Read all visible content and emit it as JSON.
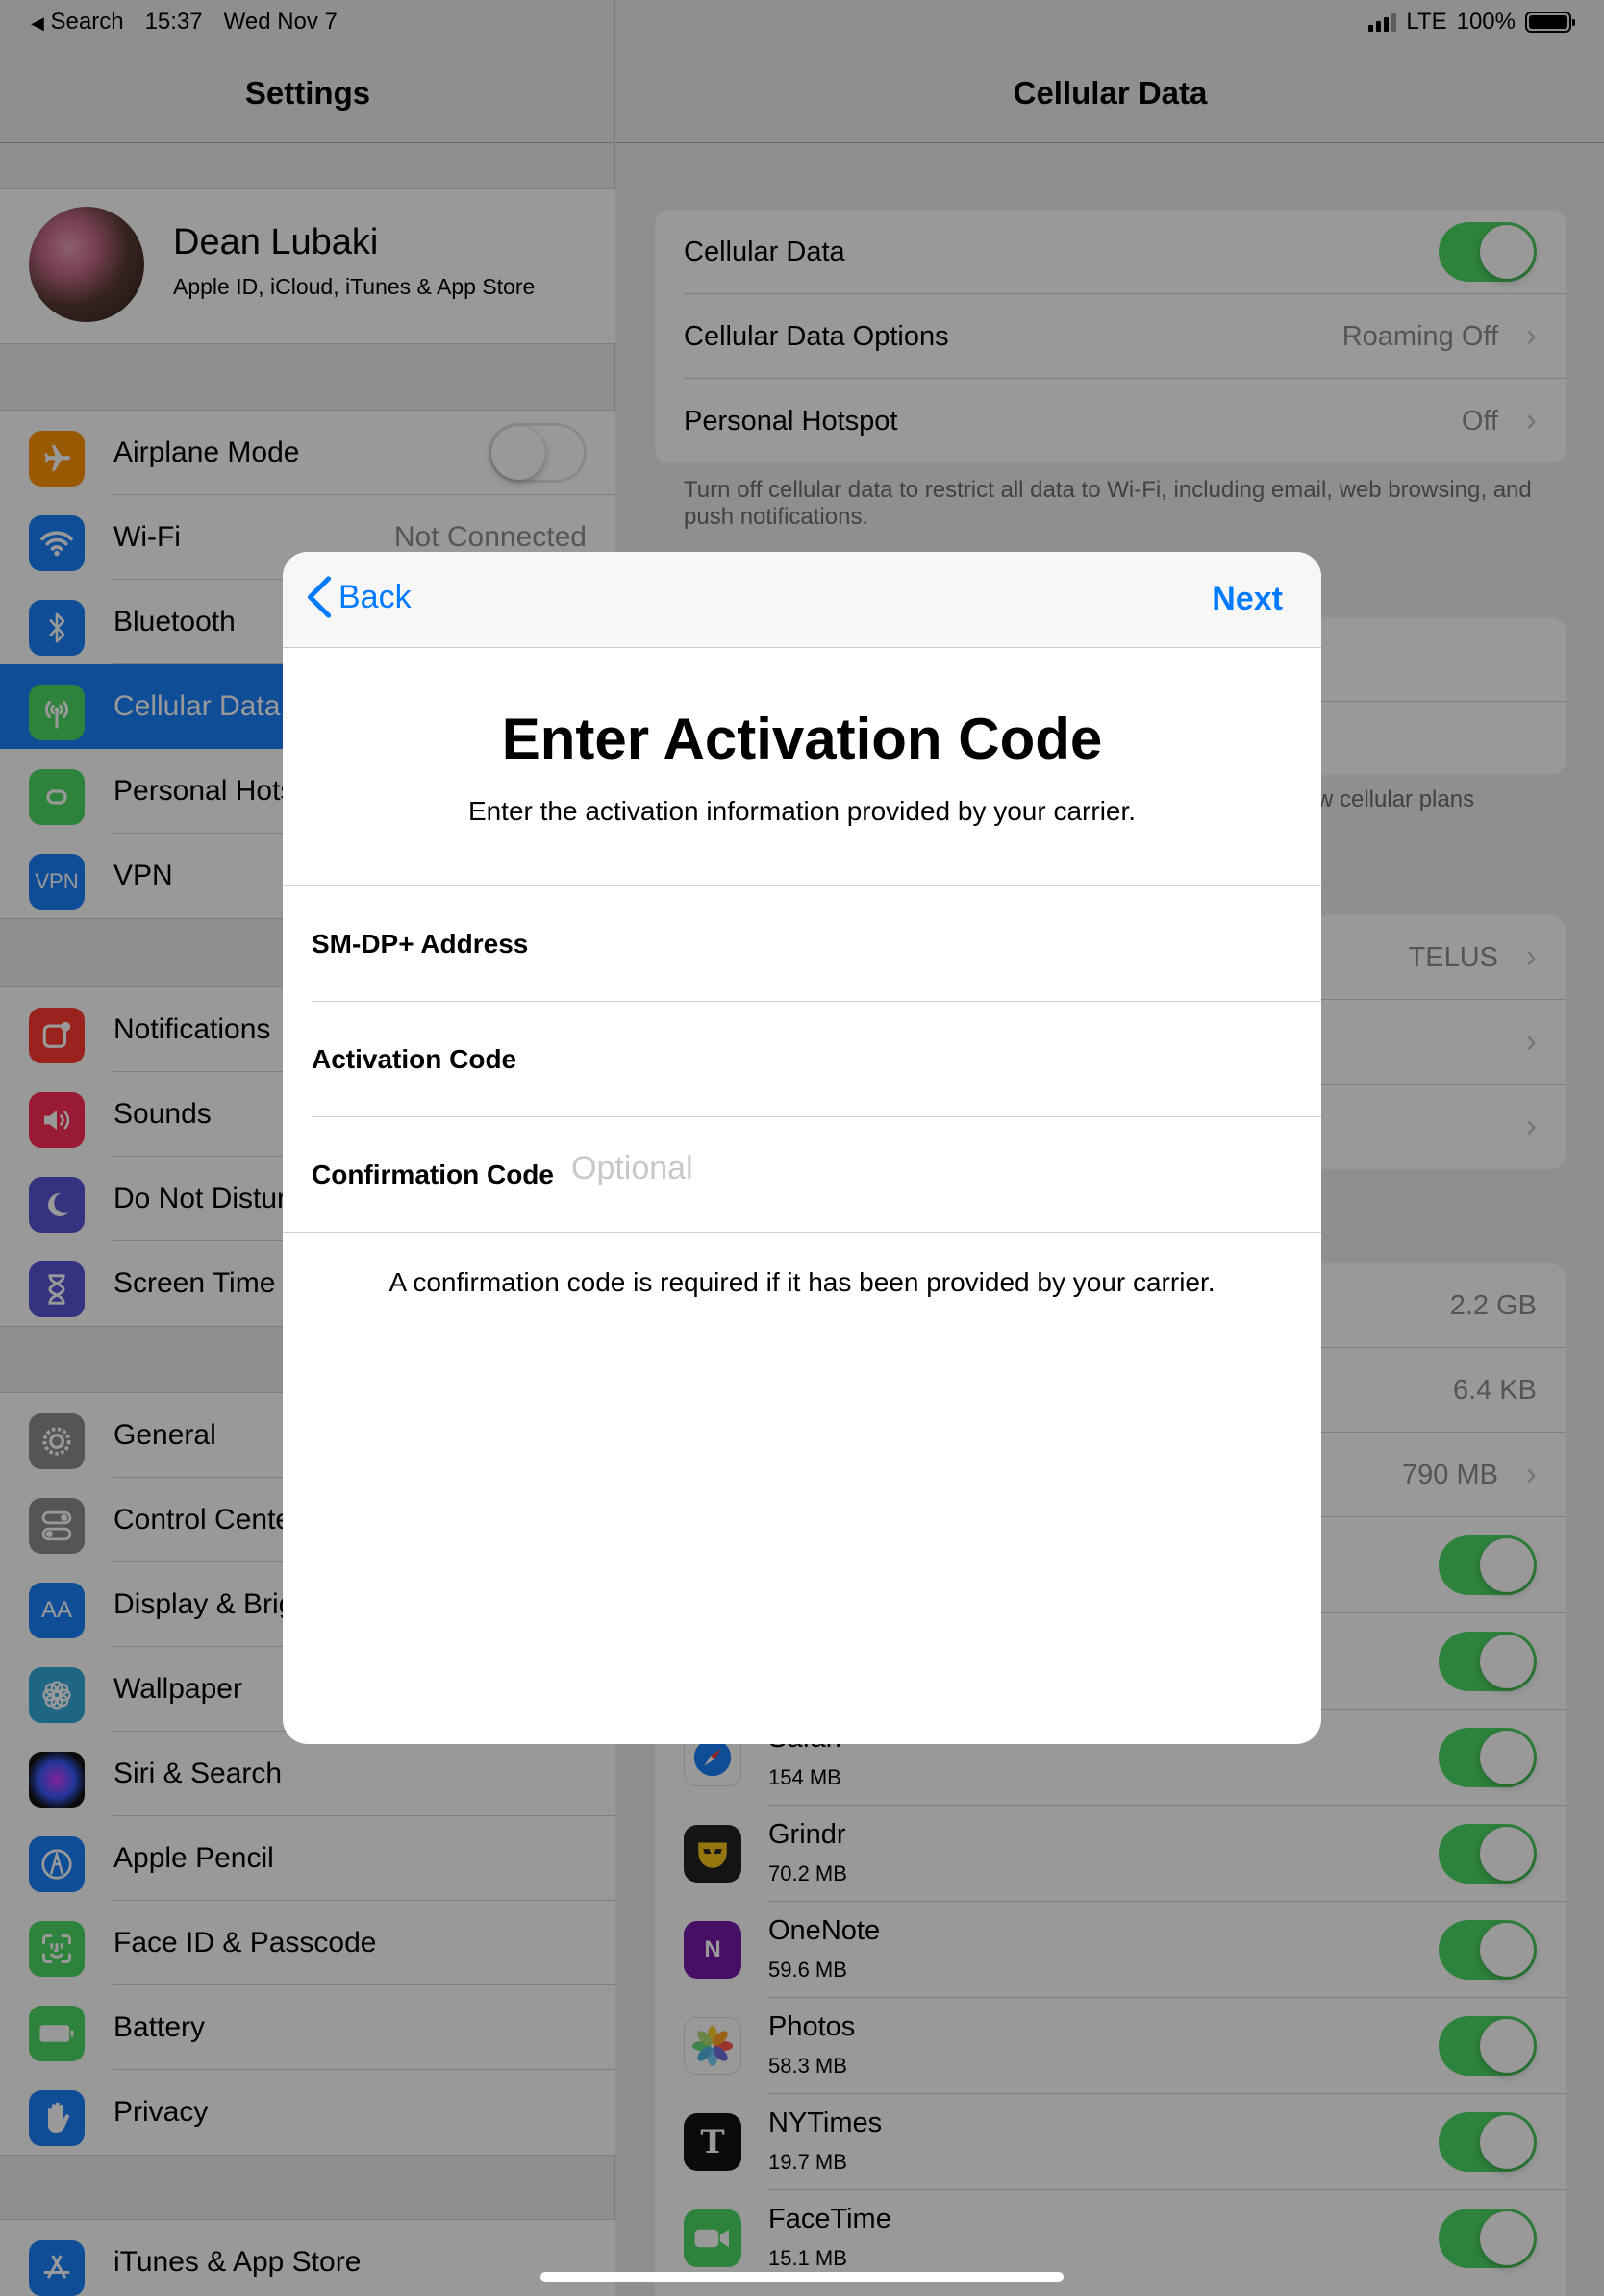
{
  "status_bar": {
    "back_app": "Search",
    "time": "15:37",
    "date": "Wed Nov 7",
    "network": "LTE",
    "battery": "100%"
  },
  "master": {
    "title": "Settings",
    "profile": {
      "name": "Dean Lubaki",
      "subtitle": "Apple ID, iCloud, iTunes & App Store"
    },
    "groups": [
      {
        "items": [
          {
            "label": "Airplane Mode",
            "icon": "airplane-icon",
            "color": "#ff9500",
            "toggle": false
          },
          {
            "label": "Wi-Fi",
            "icon": "wifi-icon",
            "color": "#1a82fb",
            "value": "Not Connected"
          },
          {
            "label": "Bluetooth",
            "icon": "bluetooth-icon",
            "color": "#1a82fb"
          },
          {
            "label": "Cellular Data",
            "icon": "antenna-icon",
            "color": "#4cd964",
            "selected": true
          },
          {
            "label": "Personal Hots",
            "icon": "hotspot-icon",
            "color": "#4cd964"
          },
          {
            "label": "VPN",
            "icon": "vpn-icon",
            "color": "#1a82fb",
            "glyph": "VPN"
          }
        ]
      },
      {
        "items": [
          {
            "label": "Notifications",
            "icon": "notifications-icon",
            "color": "#ff3b30"
          },
          {
            "label": "Sounds",
            "icon": "speaker-icon",
            "color": "#ff2d55"
          },
          {
            "label": "Do Not Distur",
            "icon": "moon-icon",
            "color": "#5856d6"
          },
          {
            "label": "Screen Time",
            "icon": "hourglass-icon",
            "color": "#5856d6"
          }
        ]
      },
      {
        "items": [
          {
            "label": "General",
            "icon": "gear-icon",
            "color": "#8e8e93"
          },
          {
            "label": "Control Cente",
            "icon": "switches-icon",
            "color": "#8e8e93"
          },
          {
            "label": "Display & Brig",
            "icon": "text-size-icon",
            "color": "#1a82fb",
            "glyph": "AA"
          },
          {
            "label": "Wallpaper",
            "icon": "flower-icon",
            "color": "#34aadc"
          },
          {
            "label": "Siri & Search",
            "icon": "siri-icon",
            "color": "#222222"
          },
          {
            "label": "Apple Pencil",
            "icon": "pencil-icon",
            "color": "#1a82fb"
          },
          {
            "label": "Face ID & Passcode",
            "icon": "face-id-icon",
            "color": "#4cd964"
          },
          {
            "label": "Battery",
            "icon": "battery-icon",
            "color": "#4cd964"
          },
          {
            "label": "Privacy",
            "icon": "hand-icon",
            "color": "#1a82fb"
          }
        ]
      },
      {
        "items": [
          {
            "label": "iTunes & App Store",
            "icon": "app-store-icon",
            "color": "#1a82fb"
          }
        ]
      }
    ]
  },
  "detail": {
    "title": "Cellular Data",
    "top_rows": [
      {
        "label": "Cellular Data",
        "toggle": true
      },
      {
        "label": "Cellular Data Options",
        "value": "Roaming Off"
      },
      {
        "label": "Personal Hotspot",
        "value": "Off"
      }
    ],
    "footer": "Turn off cellular data to restrict all data to Wi-Fi, including email, web browsing, and push notifications.",
    "plans_footer": "w cellular plans",
    "carrier_rows": [
      {
        "value": "TELUS"
      },
      {
        "value": ""
      },
      {
        "value": ""
      }
    ],
    "usage_rows": [
      {
        "value": "2.2 GB"
      },
      {
        "value": "6.4 KB"
      },
      {
        "value": "790 MB"
      }
    ],
    "apps": [
      {
        "name": "",
        "size": "",
        "icon": "app-icon",
        "color": "#ffffff"
      },
      {
        "name": "",
        "size": "",
        "icon": "app-icon",
        "color": "#ffffff"
      },
      {
        "name": "Safari",
        "size": "154 MB",
        "icon": "compass-icon",
        "color": "#1a82fb"
      },
      {
        "name": "Grindr",
        "size": "70.2 MB",
        "icon": "mask-icon",
        "color": "#222222"
      },
      {
        "name": "OneNote",
        "size": "59.6 MB",
        "icon": "onenote-icon",
        "color": "#7719aa"
      },
      {
        "name": "Photos",
        "size": "58.3 MB",
        "icon": "photos-icon",
        "color": "#ffffff"
      },
      {
        "name": "NYTimes",
        "size": "19.7 MB",
        "icon": "nyt-icon",
        "color": "#111111"
      },
      {
        "name": "FaceTime",
        "size": "15.1 MB",
        "icon": "video-camera-icon",
        "color": "#4cd964"
      }
    ]
  },
  "modal": {
    "back_label": "Back",
    "next_label": "Next",
    "title": "Enter Activation Code",
    "subtitle": "Enter the activation information provided by your carrier.",
    "fields": [
      {
        "label": "SM-DP+ Address",
        "value": "",
        "placeholder": ""
      },
      {
        "label": "Activation Code",
        "value": "",
        "placeholder": ""
      },
      {
        "label": "Confirmation Code",
        "value": "",
        "placeholder": "Optional"
      }
    ],
    "note": "A confirmation code is required if it has been provided by your carrier."
  },
  "colors": {
    "accent": "#007aff",
    "toggle_on": "#4cd964",
    "selected_row": "#1a82fb"
  }
}
